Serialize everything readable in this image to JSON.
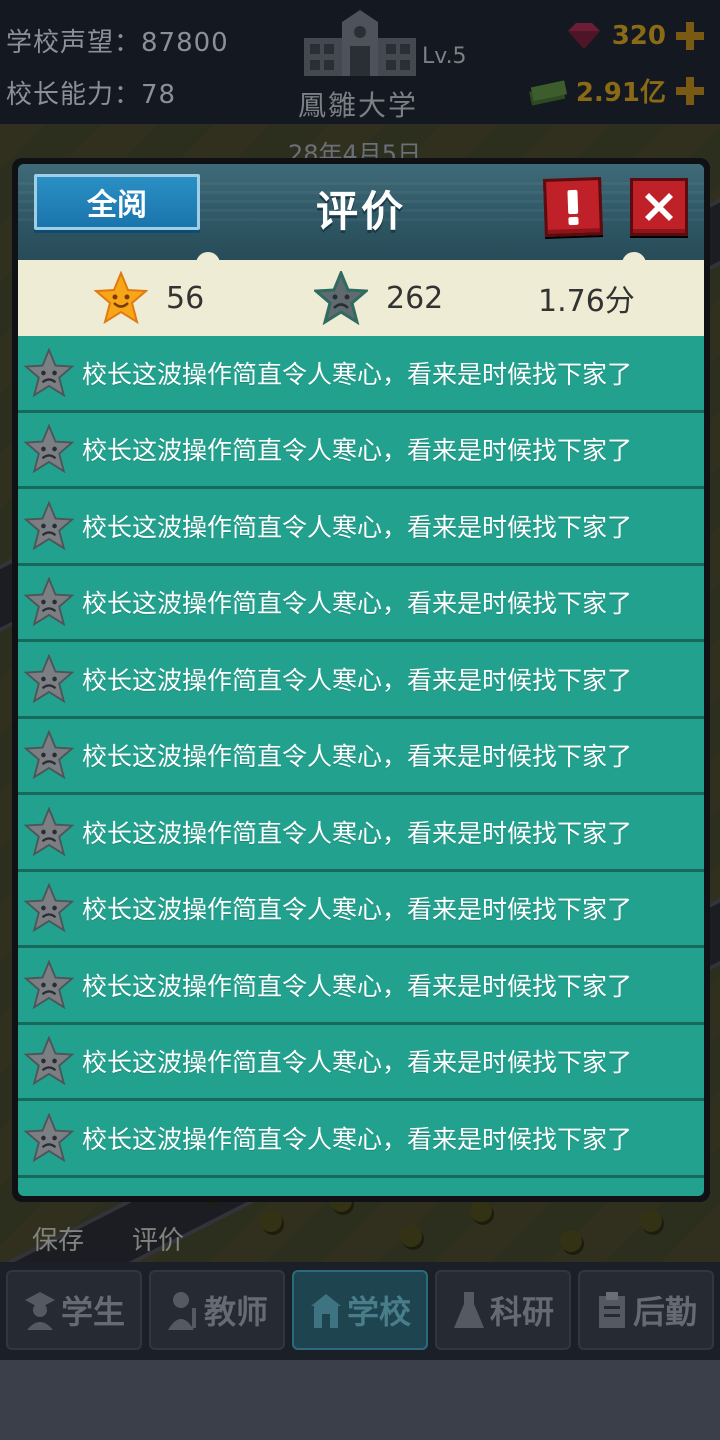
{
  "hud": {
    "reputation_label": "学校声望：87800",
    "ability_label": "校长能力：78",
    "level": "Lv.5",
    "school_name": "鳳雛大学",
    "gems": "320",
    "money": "2.91亿",
    "date": "28年4月5日"
  },
  "modal": {
    "read_all": "全阅",
    "title": "评价",
    "good_count": "56",
    "bad_count": "262",
    "score": "1.76分"
  },
  "reviews": [
    {
      "sentiment": "negative",
      "text": "校长这波操作简直令人寒心，看来是时候找下家了"
    },
    {
      "sentiment": "negative",
      "text": "校长这波操作简直令人寒心，看来是时候找下家了"
    },
    {
      "sentiment": "negative",
      "text": "校长这波操作简直令人寒心，看来是时候找下家了"
    },
    {
      "sentiment": "negative",
      "text": "校长这波操作简直令人寒心，看来是时候找下家了"
    },
    {
      "sentiment": "negative",
      "text": "校长这波操作简直令人寒心，看来是时候找下家了"
    },
    {
      "sentiment": "negative",
      "text": "校长这波操作简直令人寒心，看来是时候找下家了"
    },
    {
      "sentiment": "negative",
      "text": "校长这波操作简直令人寒心，看来是时候找下家了"
    },
    {
      "sentiment": "negative",
      "text": "校长这波操作简直令人寒心，看来是时候找下家了"
    },
    {
      "sentiment": "negative",
      "text": "校长这波操作简直令人寒心，看来是时候找下家了"
    },
    {
      "sentiment": "negative",
      "text": "校长这波操作简直令人寒心，看来是时候找下家了"
    },
    {
      "sentiment": "negative",
      "text": "校长这波操作简直令人寒心，看来是时候找下家了"
    }
  ],
  "bottom_actions": {
    "save": "保存",
    "review": "评价"
  },
  "nav": {
    "tabs": [
      "学生",
      "教师",
      "学校",
      "科研",
      "后勤"
    ],
    "active_index": 2
  },
  "colors": {
    "review_bg": "#22a28e",
    "header_bg": "#2e5664",
    "accent_red": "#c02027",
    "read_all_blue": "#1b75ad"
  },
  "icons": {
    "good": "smiling-gold-star-icon",
    "bad": "frowning-gray-star-icon",
    "alert": "exclamation-icon",
    "close": "close-x-icon"
  }
}
